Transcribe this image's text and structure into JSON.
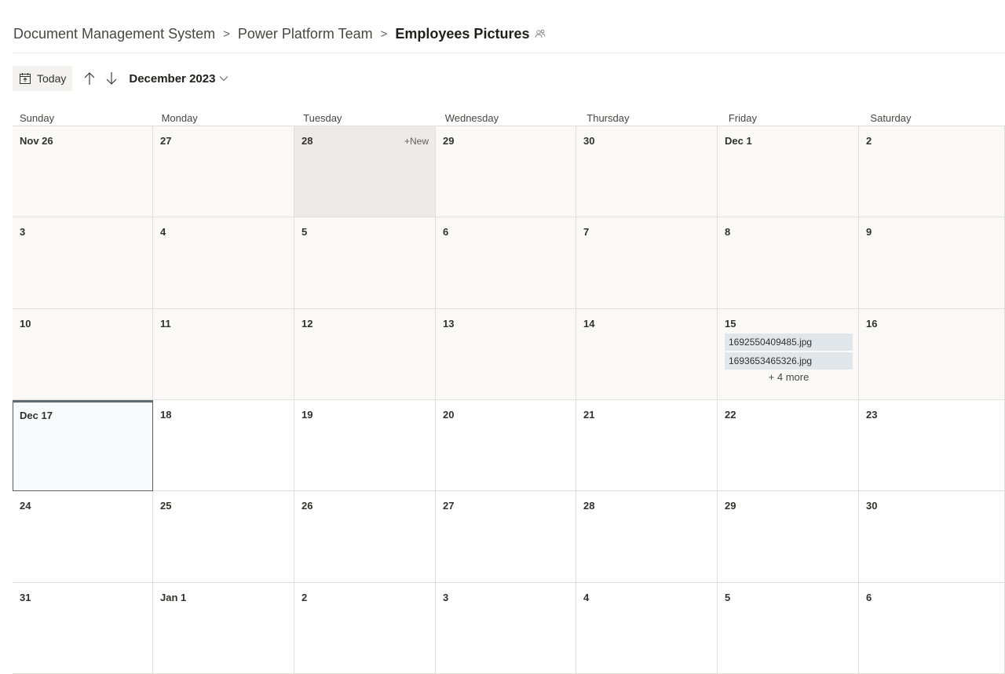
{
  "breadcrumb": {
    "items": [
      "Document Management System",
      "Power Platform Team"
    ],
    "current": "Employees Pictures",
    "separator": ">"
  },
  "toolbar": {
    "today_label": "Today",
    "month_label": "December 2023",
    "icons": [
      "calendar-today-icon",
      "arrow-up-icon",
      "arrow-down-icon",
      "chevron-down-icon"
    ]
  },
  "calendar": {
    "days_of_week": [
      "Sunday",
      "Monday",
      "Tuesday",
      "Wednesday",
      "Thursday",
      "Friday",
      "Saturday"
    ],
    "new_label": "+New",
    "weeks": [
      [
        "Nov 26",
        "27",
        "28",
        "29",
        "30",
        "Dec 1",
        "2"
      ],
      [
        "3",
        "4",
        "5",
        "6",
        "7",
        "8",
        "9"
      ],
      [
        "10",
        "11",
        "12",
        "13",
        "14",
        "15",
        "16"
      ],
      [
        "Dec 17",
        "18",
        "19",
        "20",
        "21",
        "22",
        "23"
      ],
      [
        "24",
        "25",
        "26",
        "27",
        "28",
        "29",
        "30"
      ],
      [
        "31",
        "Jan 1",
        "2",
        "3",
        "4",
        "5",
        "6"
      ]
    ],
    "events": {
      "friday_15": [
        "1692550409485.jpg",
        "1693653465326.jpg"
      ],
      "more_label": "+ 4 more"
    }
  },
  "colors": {
    "past_cell": "#faf9f8",
    "hover_cell": "#edebe9",
    "today_border": "#5f6b73",
    "event_bg": "#e1e6ea"
  }
}
